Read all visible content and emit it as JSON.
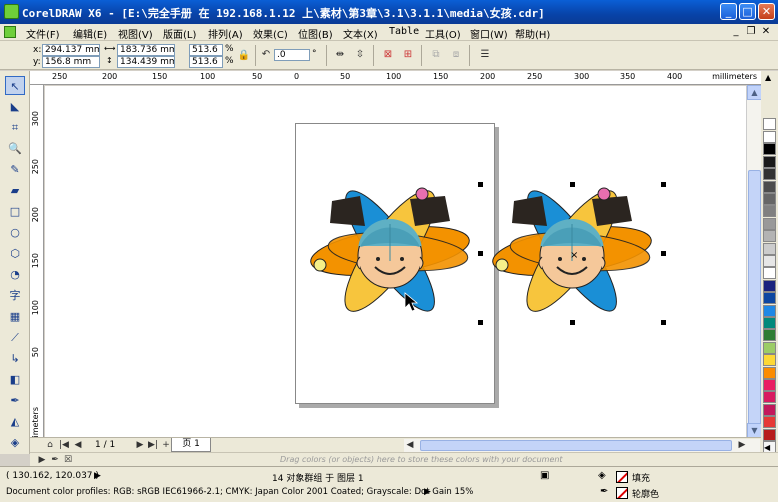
{
  "window": {
    "title": "CorelDRAW X6 - [E:\\完全手册 在 192.168.1.12 上\\素材\\第3章\\3.1\\3.1.1\\media\\女孩.cdr]",
    "minimize": "_",
    "maximize": "□",
    "close": "✕"
  },
  "menu": {
    "items": [
      "文件(F)",
      "编辑(E)",
      "视图(V)",
      "版面(L)",
      "排列(A)",
      "效果(C)",
      "位图(B)",
      "文本(X)",
      "Table",
      "工具(O)",
      "窗口(W)",
      "帮助(H)"
    ],
    "doc_min": "_",
    "doc_restore": "❐",
    "doc_close": "✕"
  },
  "property_bar": {
    "x_label": "x:",
    "x_value": "294.137 mm",
    "y_label": "y:",
    "y_value": "156.8 mm",
    "width_value": "183.736 mm",
    "height_value": "134.439 mm",
    "scale_x": "513.6",
    "scale_y": "513.6",
    "percent": "%",
    "rotation_value": ".0",
    "degree": "°"
  },
  "ruler": {
    "h_ticks": [
      "250",
      "200",
      "150",
      "100",
      "50",
      "0",
      "50",
      "100",
      "150",
      "200",
      "250",
      "300",
      "350",
      "400"
    ],
    "v_ticks": [
      "300",
      "250",
      "200",
      "150",
      "100",
      "50"
    ],
    "units": "millimeters",
    "units_v": "millimeters"
  },
  "page_nav": {
    "count": "1 / 1",
    "tab_label": "页 1"
  },
  "docker_hint": "Drag colors (or objects) here to store these colors with your document",
  "status": {
    "coords": "( 130.162, 120.037 )",
    "selection": "14 对象群组 于 图层 1",
    "color_profiles": "Document color profiles: RGB: sRGB IEC61966-2.1; CMYK: Japan Color 2001 Coated; Grayscale: Dot Gain 15%",
    "fill_label": "填充",
    "outline_label": "轮廓色"
  },
  "palette": {
    "colors": [
      "#ffffff",
      "#000000",
      "#1a1a1a",
      "#333333",
      "#4d4d4d",
      "#666666",
      "#808080",
      "#999999",
      "#b3b3b3",
      "#cccccc",
      "#e6e6e6",
      "#ffffff",
      "#1a237e",
      "#0d47a1",
      "#1e88e5",
      "#00897b",
      "#2e7d32",
      "#9ccc65",
      "#fdd835",
      "#fb8c00",
      "#e91e63",
      "#d81b60",
      "#c2185b",
      "#e53935",
      "#b71c1c",
      "#f5f5f5"
    ]
  },
  "colors": {
    "title_bar": "#0a4fc2",
    "chrome": "#ece9d8",
    "orange": "#f39200",
    "blue": "#1a8fd6",
    "yellow": "#f7c53d",
    "skin": "#f5c89a",
    "hair": "#2b2520"
  }
}
